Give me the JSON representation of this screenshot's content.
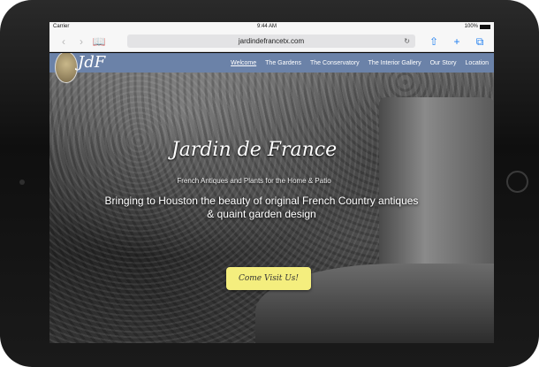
{
  "status_bar": {
    "carrier": "Carrier",
    "time": "9:44 AM",
    "battery": "100%"
  },
  "browser": {
    "url": "jardindefrancetx.com",
    "icons": {
      "back": "chevron-left-icon",
      "forward": "chevron-right-icon",
      "bookmarks": "book-icon",
      "reload": "reload-icon",
      "share": "share-icon",
      "new_tab": "plus-icon",
      "tabs": "tabs-icon"
    }
  },
  "site": {
    "logo_text": "JdF",
    "nav": [
      {
        "label": "Welcome",
        "active": true
      },
      {
        "label": "The Gardens"
      },
      {
        "label": "The Conservatory"
      },
      {
        "label": "The Interior Gallery"
      },
      {
        "label": "Our Story"
      },
      {
        "label": "Location"
      }
    ],
    "hero": {
      "title": "Jardin de France",
      "subtitle": "French Antiques and Plants for the Home & Patio",
      "description": "Bringing to Houston the beauty of original French Country antiques & quaint garden design",
      "cta": "Come Visit Us!"
    }
  },
  "colors": {
    "nav_bg": "#6b82a8",
    "cta_bg": "#f4ee7e",
    "link_blue": "#1e7ef0"
  }
}
